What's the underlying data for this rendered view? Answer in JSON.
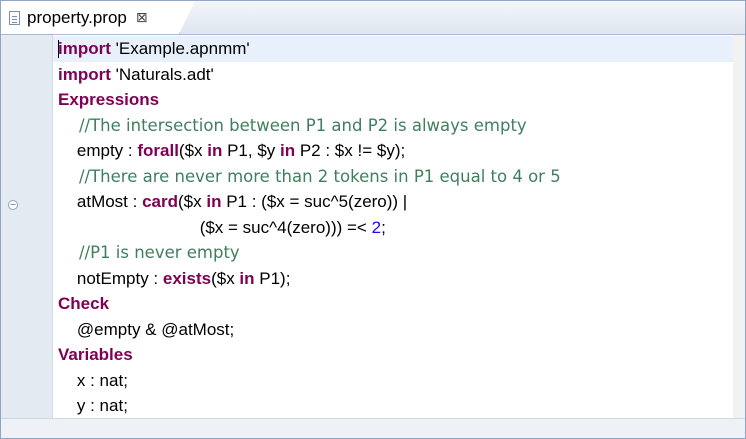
{
  "editor": {
    "tab": {
      "title": "property.prop",
      "close_glyph": "⊠",
      "file_icon": "document-icon"
    }
  },
  "code": {
    "lines": [
      {
        "segments": [
          {
            "t": "kw",
            "s": "import"
          },
          {
            "t": "tx",
            "s": " 'Example.apnmm'"
          }
        ]
      },
      {
        "segments": [
          {
            "t": "kw",
            "s": "import"
          },
          {
            "t": "tx",
            "s": " 'Naturals.adt'"
          }
        ]
      },
      {
        "segments": [
          {
            "t": "kw",
            "s": "Expressions"
          }
        ]
      },
      {
        "segments": [
          {
            "t": "cm",
            "s": "    //The intersection between P1 and P2 is always empty"
          }
        ]
      },
      {
        "segments": [
          {
            "t": "tx",
            "s": "    empty : "
          },
          {
            "t": "kw",
            "s": "forall"
          },
          {
            "t": "tx",
            "s": "($x "
          },
          {
            "t": "kw",
            "s": "in"
          },
          {
            "t": "tx",
            "s": " P1, $y "
          },
          {
            "t": "kw",
            "s": "in"
          },
          {
            "t": "tx",
            "s": " P2 : $x != $y);"
          }
        ]
      },
      {
        "segments": [
          {
            "t": "cm",
            "s": "    //There are never more than 2 tokens in P1 equal to 4 or 5"
          }
        ]
      },
      {
        "segments": [
          {
            "t": "tx",
            "s": "    atMost : "
          },
          {
            "t": "kw",
            "s": "card"
          },
          {
            "t": "tx",
            "s": "($x "
          },
          {
            "t": "kw",
            "s": "in"
          },
          {
            "t": "tx",
            "s": " P1 : ($x = suc^5(zero)) |"
          }
        ]
      },
      {
        "segments": [
          {
            "t": "tx",
            "s": "                              ($x = suc^4(zero))) =< "
          },
          {
            "t": "num",
            "s": "2"
          },
          {
            "t": "tx",
            "s": ";"
          }
        ]
      },
      {
        "segments": [
          {
            "t": "cm",
            "s": "    //P1 is never empty"
          }
        ]
      },
      {
        "segments": [
          {
            "t": "tx",
            "s": "    notEmpty : "
          },
          {
            "t": "kw",
            "s": "exists"
          },
          {
            "t": "tx",
            "s": "($x "
          },
          {
            "t": "kw",
            "s": "in"
          },
          {
            "t": "tx",
            "s": " P1);"
          }
        ]
      },
      {
        "segments": [
          {
            "t": "kw",
            "s": "Check"
          }
        ]
      },
      {
        "segments": [
          {
            "t": "tx",
            "s": "    @empty & @atMost;"
          }
        ]
      },
      {
        "segments": [
          {
            "t": "kw",
            "s": "Variables"
          }
        ]
      },
      {
        "segments": [
          {
            "t": "tx",
            "s": "    x : nat;"
          }
        ]
      },
      {
        "segments": [
          {
            "t": "tx",
            "s": "    y : nat;"
          }
        ]
      }
    ]
  },
  "colors": {
    "keyword": "#7f0055",
    "comment": "#3f7f5f",
    "number": "#2a00ff",
    "current_line": "#e8f0fb"
  }
}
